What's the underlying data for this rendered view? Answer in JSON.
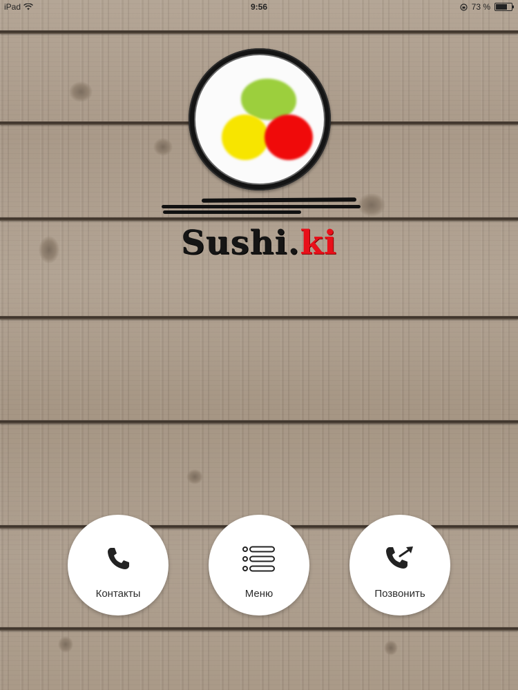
{
  "status_bar": {
    "device": "iPad",
    "time": "9:56",
    "battery": "73 %",
    "battery_level": 0.73,
    "icons": [
      "wifi-icon",
      "orientation-lock-icon",
      "battery-icon"
    ]
  },
  "logo": {
    "colors": {
      "green": "#9ccf3d",
      "yellow": "#f7e500",
      "red": "#f00a0a"
    },
    "brand_part1": "Sushi.",
    "brand_part2": "ki"
  },
  "nav": [
    {
      "label": "Контакты",
      "icon": "phone-icon"
    },
    {
      "label": "Меню",
      "icon": "list-icon"
    },
    {
      "label": "Позвонить",
      "icon": "phone-call-icon"
    }
  ],
  "theme": {
    "background": "wood",
    "accent": "#e8101a",
    "button_bg": "#ffffff"
  }
}
